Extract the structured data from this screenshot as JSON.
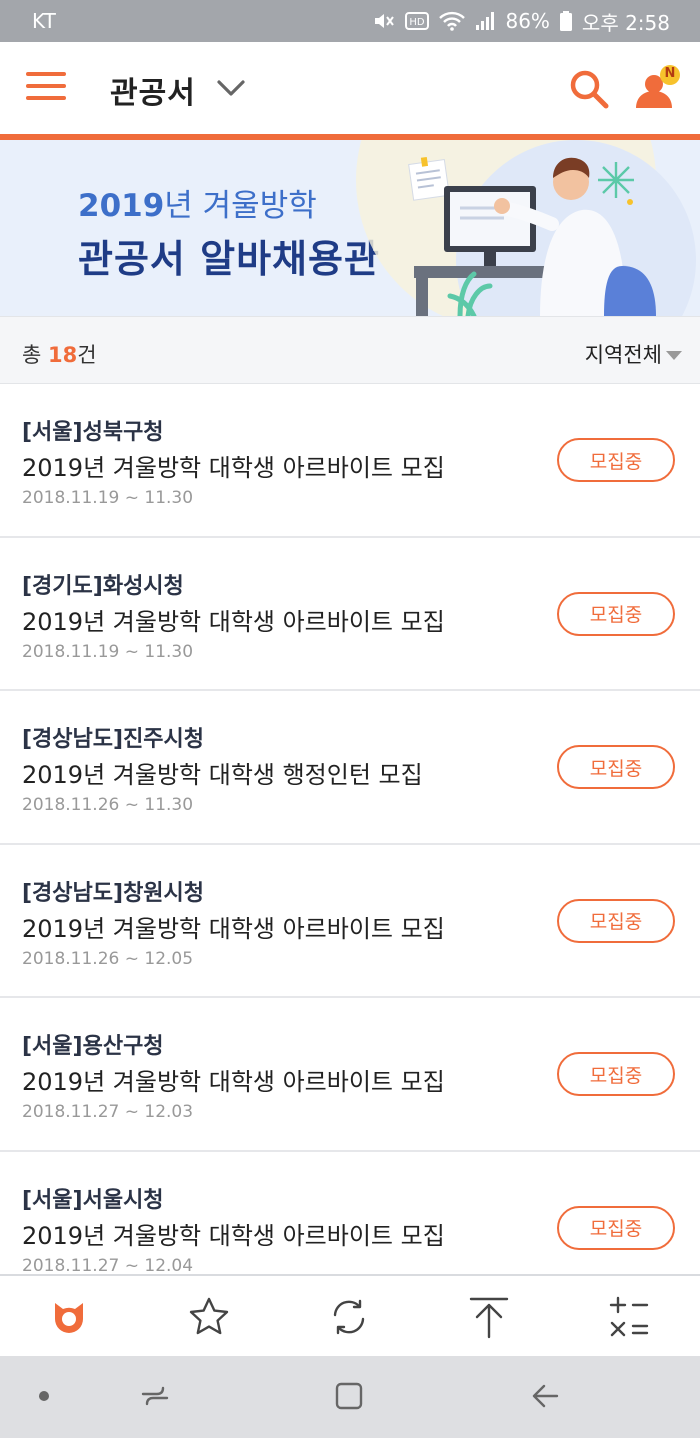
{
  "status_bar": {
    "carrier": "KT",
    "battery": "86%",
    "time": "오후 2:58"
  },
  "header": {
    "title": "관공서",
    "icons": [
      "menu-icon",
      "chevron-down-icon",
      "search-icon",
      "user-icon"
    ],
    "badge": "N"
  },
  "banner": {
    "year": "2019",
    "subtitle_rest": "년 겨울방학",
    "title": "관공서 알바채용관"
  },
  "filter": {
    "total_prefix": "총 ",
    "total_count": "18",
    "total_suffix": "건",
    "region": "지역전체"
  },
  "jobs": [
    {
      "org": "[서울]성북구청",
      "title": "2019년 겨울방학 대학생 아르바이트 모집",
      "date": "2018.11.19 ~ 11.30",
      "status": "모집중"
    },
    {
      "org": "[경기도]화성시청",
      "title": "2019년 겨울방학 대학생 아르바이트 모집",
      "date": "2018.11.19 ~ 11.30",
      "status": "모집중"
    },
    {
      "org": "[경상남도]진주시청",
      "title": "2019년 겨울방학 대학생 행정인턴 모집",
      "date": "2018.11.26 ~ 11.30",
      "status": "모집중"
    },
    {
      "org": "[경상남도]창원시청",
      "title": "2019년 겨울방학 대학생 아르바이트 모집",
      "date": "2018.11.26 ~ 12.05",
      "status": "모집중"
    },
    {
      "org": "[서울]용산구청",
      "title": "2019년 겨울방학 대학생 아르바이트 모집",
      "date": "2018.11.27 ~ 12.03",
      "status": "모집중"
    },
    {
      "org": "[서울]서울시청",
      "title": "2019년 겨울방학 대학생 아르바이트 모집",
      "date": "2018.11.27 ~ 12.04",
      "status": "모집중"
    }
  ],
  "tab_bar": [
    "home-icon",
    "star-icon",
    "refresh-icon",
    "scroll-top-icon",
    "calculator-icon"
  ],
  "colors": {
    "accent": "#f06c3b",
    "banner_bg": "#e9f0fb",
    "banner_title": "#1f3c86",
    "banner_sub": "#3d6fc9"
  }
}
